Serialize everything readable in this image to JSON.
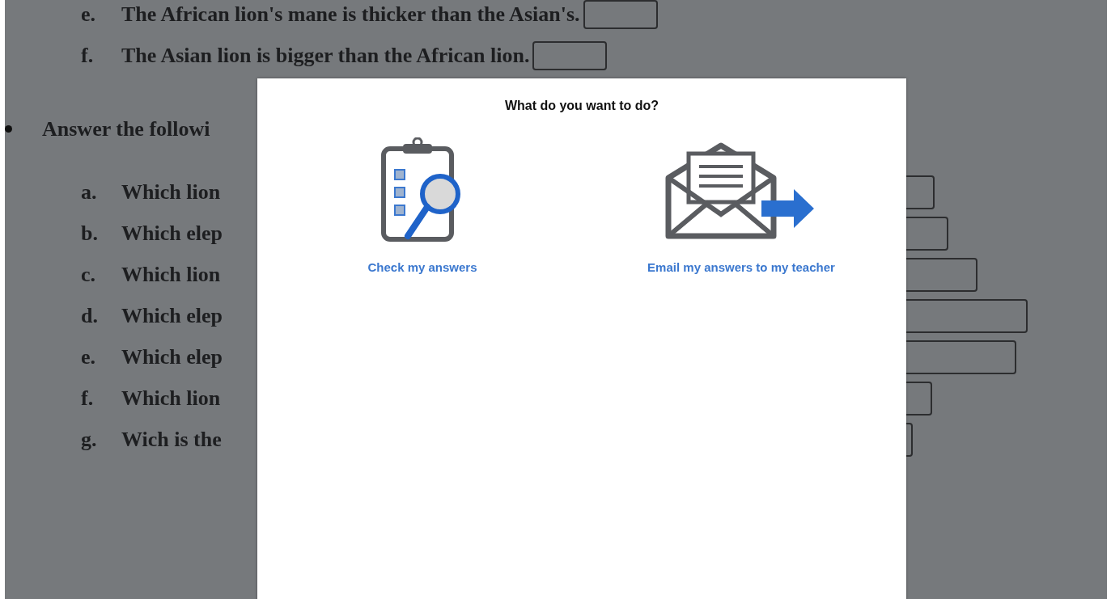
{
  "document": {
    "statements": [
      {
        "letter": "e.",
        "text": "The African lion's mane is thicker than the Asian's."
      },
      {
        "letter": "f.",
        "text": "The Asian lion is bigger than the African lion."
      }
    ],
    "instruction": "Answer the followi",
    "questions": [
      {
        "letter": "a.",
        "text": "Which lion"
      },
      {
        "letter": "b.",
        "text": "Which elep"
      },
      {
        "letter": "c.",
        "text": "Which lion"
      },
      {
        "letter": "d.",
        "text": "Which elep"
      },
      {
        "letter": "e.",
        "text": "Which elep"
      },
      {
        "letter": "f.",
        "text": "Which lion"
      },
      {
        "letter": "g.",
        "text": "Wich is the"
      }
    ]
  },
  "dialog": {
    "title": "What do you want to do?",
    "options": [
      {
        "kind": "check",
        "label": "Check my answers"
      },
      {
        "kind": "email",
        "label": "Email my answers to my teacher"
      }
    ]
  }
}
